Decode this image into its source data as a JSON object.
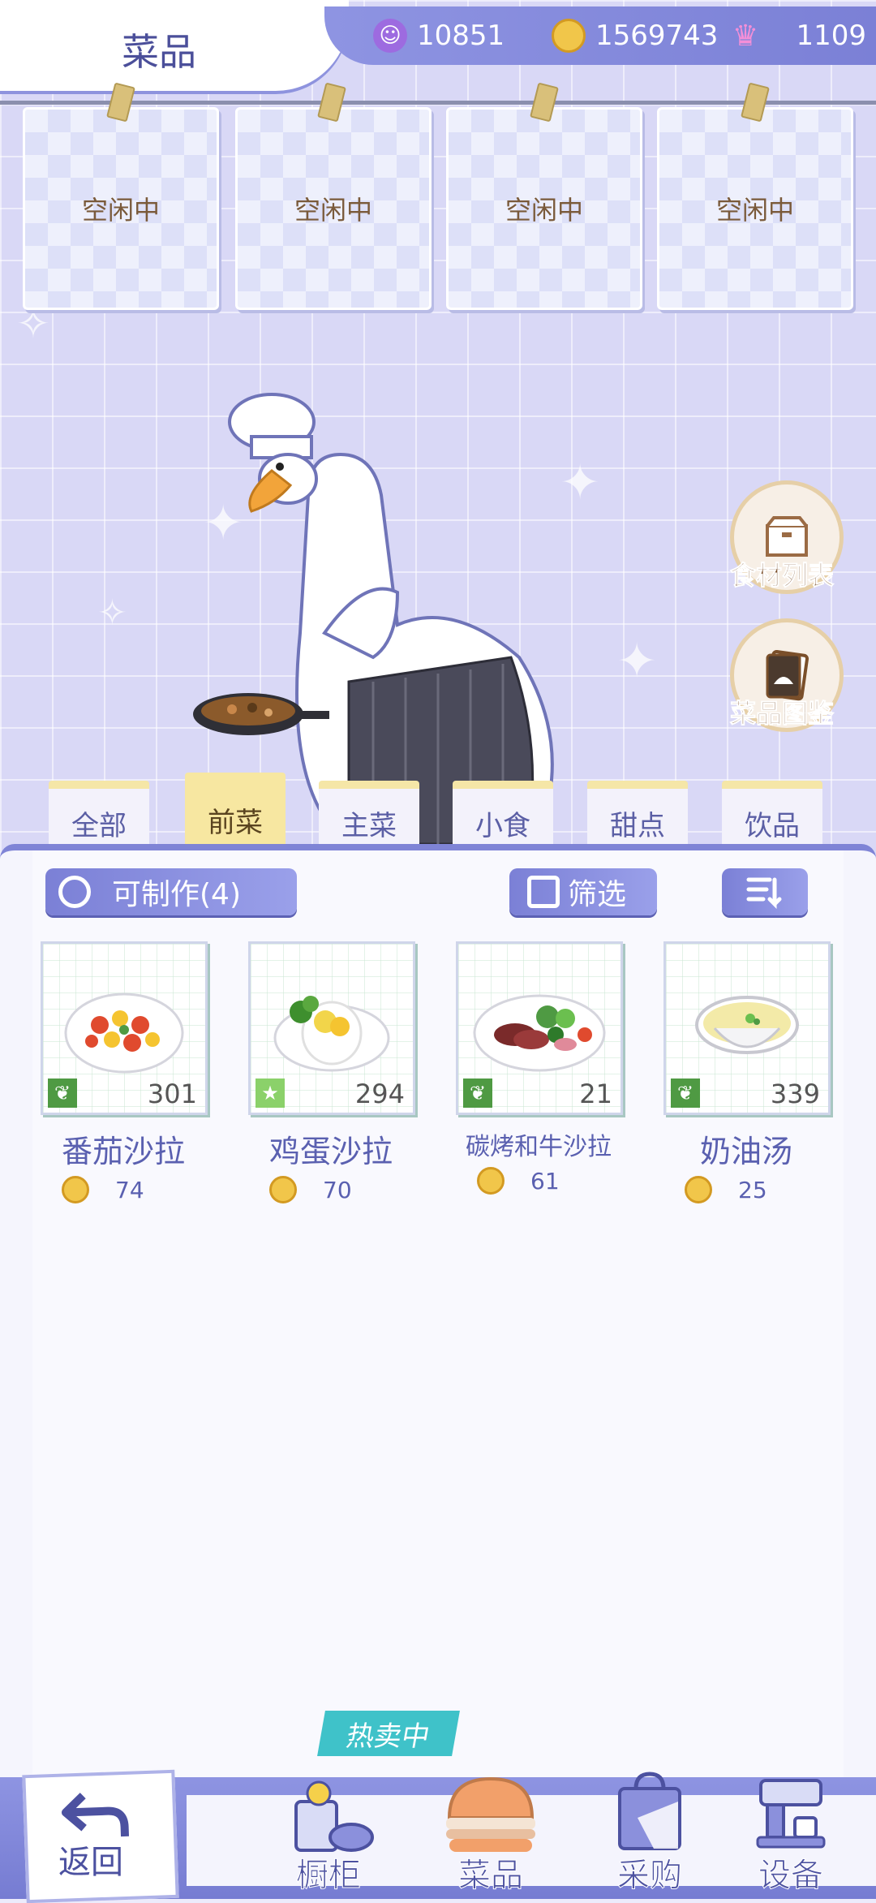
{
  "header": {
    "title": "菜品",
    "currencies": [
      {
        "icon": "purple-gem-icon",
        "value": "10851"
      },
      {
        "icon": "gold-coin-icon",
        "value": "1569743"
      },
      {
        "icon": "pink-swan-icon",
        "value": "1109"
      }
    ]
  },
  "slots": [
    {
      "label": "空闲中"
    },
    {
      "label": "空闲中"
    },
    {
      "label": "空闲中"
    },
    {
      "label": "空闲中"
    }
  ],
  "side_buttons": [
    {
      "label": "食材列表",
      "icon": "box-icon"
    },
    {
      "label": "菜品图鉴",
      "icon": "recipe-book-icon"
    }
  ],
  "tabs": [
    {
      "label": "全部",
      "active": false
    },
    {
      "label": "前菜",
      "active": true
    },
    {
      "label": "主菜",
      "active": false
    },
    {
      "label": "小食",
      "active": false
    },
    {
      "label": "甜点",
      "active": false
    },
    {
      "label": "饮品",
      "active": false
    }
  ],
  "toolbar": {
    "craftable": "可制作(4)",
    "filter": "筛选"
  },
  "dishes": [
    {
      "name": "番茄沙拉",
      "count": "301",
      "price": "74",
      "badge": "leaf-icon"
    },
    {
      "name": "鸡蛋沙拉",
      "count": "294",
      "price": "70",
      "badge": "star-icon"
    },
    {
      "name": "碳烤和牛沙拉",
      "count": "21",
      "price": "61",
      "badge": "leaf-icon"
    },
    {
      "name": "奶油汤",
      "count": "339",
      "price": "25",
      "badge": "leaf-icon"
    }
  ],
  "bottom_nav": {
    "back": "返回",
    "hot_tag": "热卖中",
    "items": [
      {
        "label": "橱柜",
        "icon": "cabinet-icon"
      },
      {
        "label": "菜品",
        "icon": "burger-icon"
      },
      {
        "label": "采购",
        "icon": "shopping-bag-icon"
      },
      {
        "label": "设备",
        "icon": "coffee-machine-icon"
      }
    ]
  },
  "colors": {
    "accent": "#7b80d6",
    "tab_active": "#f7e7a1",
    "text_blue": "#5a60b0"
  }
}
